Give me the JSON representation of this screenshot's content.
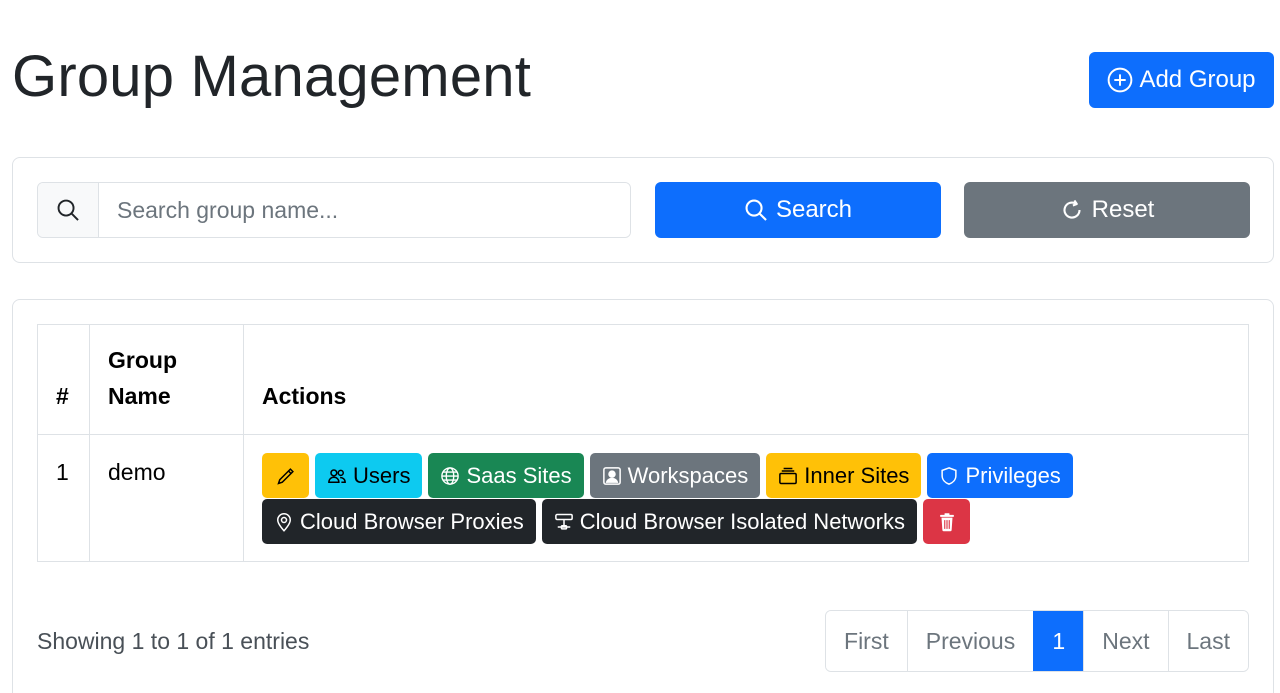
{
  "header": {
    "title": "Group Management",
    "add_button_label": "Add Group"
  },
  "search": {
    "placeholder": "Search group name...",
    "value": "",
    "search_button_label": "Search",
    "reset_button_label": "Reset"
  },
  "table": {
    "columns": [
      "#",
      "Group Name",
      "Actions"
    ],
    "rows": [
      {
        "num": "1",
        "name": "demo",
        "actions": {
          "edit_icon": "pencil-icon",
          "users": "Users",
          "saas_sites": "Saas Sites",
          "workspaces": "Workspaces",
          "inner_sites": "Inner Sites",
          "privileges": "Privileges",
          "cloud_browser_proxies": "Cloud Browser Proxies",
          "cloud_browser_isolated_networks": "Cloud Browser Isolated Networks",
          "delete_icon": "trash-icon"
        }
      }
    ]
  },
  "footer": {
    "showing": "Showing 1 to 1 of 1 entries",
    "pagination": {
      "first": "First",
      "previous": "Previous",
      "current": "1",
      "next": "Next",
      "last": "Last"
    }
  },
  "colors": {
    "primary": "#0d6efd",
    "secondary": "#6c757d",
    "success": "#198754",
    "info": "#0dcaf0",
    "warning": "#ffc107",
    "danger": "#dc3545",
    "dark": "#212529"
  }
}
